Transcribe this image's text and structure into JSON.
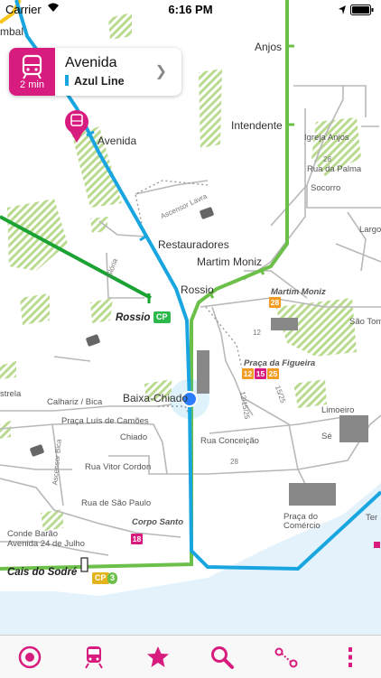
{
  "status": {
    "carrier": "Carrier",
    "time": "6:16 PM"
  },
  "popup": {
    "title": "Avenida",
    "minutes": "2 min",
    "line": "Azul Line"
  },
  "colors": {
    "blue_line": "#19a6e0",
    "green_line": "#6cc04a",
    "dark_green_line": "#1aa233",
    "accent": "#d81b7e",
    "water": "#e3f2fb",
    "tram_orange": "#f39c22",
    "tram_pink": "#d81b7e"
  },
  "labels": {
    "anjos": "Anjos",
    "intendente": "Intendente",
    "igreja_anjos": "Igreja Anjos",
    "rua_da_palma": "Rua da Palma",
    "socorro": "Socorro",
    "largo": "Largo",
    "avenida": "Avenida",
    "restauradores": "Restauradores",
    "martim_moniz": "Martim Moniz",
    "martim_moniz_tram": "Martim Moniz",
    "rossio": "Rossio",
    "rossio_bold": "Rossio",
    "sao_tome": "São Tome",
    "praca_figueira": "Praça da Figueira",
    "baixa_chiado": "Baixa-Chiado",
    "calhariz": "Calhariz / Bica",
    "luis_camoes": "Praça Luís de Camões",
    "chiado": "Chiado",
    "rua_conceicao": "Rua Conceição",
    "vitor_cordon": "Rua Vitor Cordon",
    "sao_paulo": "Rua de São Paulo",
    "corpo_santo": "Corpo Santo",
    "conde_barao": "Conde Barão",
    "av_24_julho": "Avenida 24 de Julho",
    "cais_sodre": "Cais do Sodré",
    "limoeiro": "Limoeiro",
    "se": "Sé",
    "praca_comercio_1": "Praça do",
    "praca_comercio_2": "Comércio",
    "estrela": "strela",
    "ter": "Ter",
    "mbal": "mbal",
    "ascensor_lavra": "Ascensor Lavra",
    "ascensor_gloria": "Glória",
    "ascensor_bica": "Ascensor Bica",
    "route_28": "28",
    "route_12": "12",
    "route_1225": "12/15/25",
    "route_1525": "15/25"
  },
  "badges": {
    "cp": "CP",
    "green_3": "3",
    "tram_28": "28",
    "tram_12": "12",
    "tram_15": "15",
    "tram_25": "25",
    "tram_18": "18"
  },
  "tabs": [
    "target-icon",
    "train-icon",
    "star-icon",
    "search-icon",
    "route-icon",
    "more-icon"
  ]
}
